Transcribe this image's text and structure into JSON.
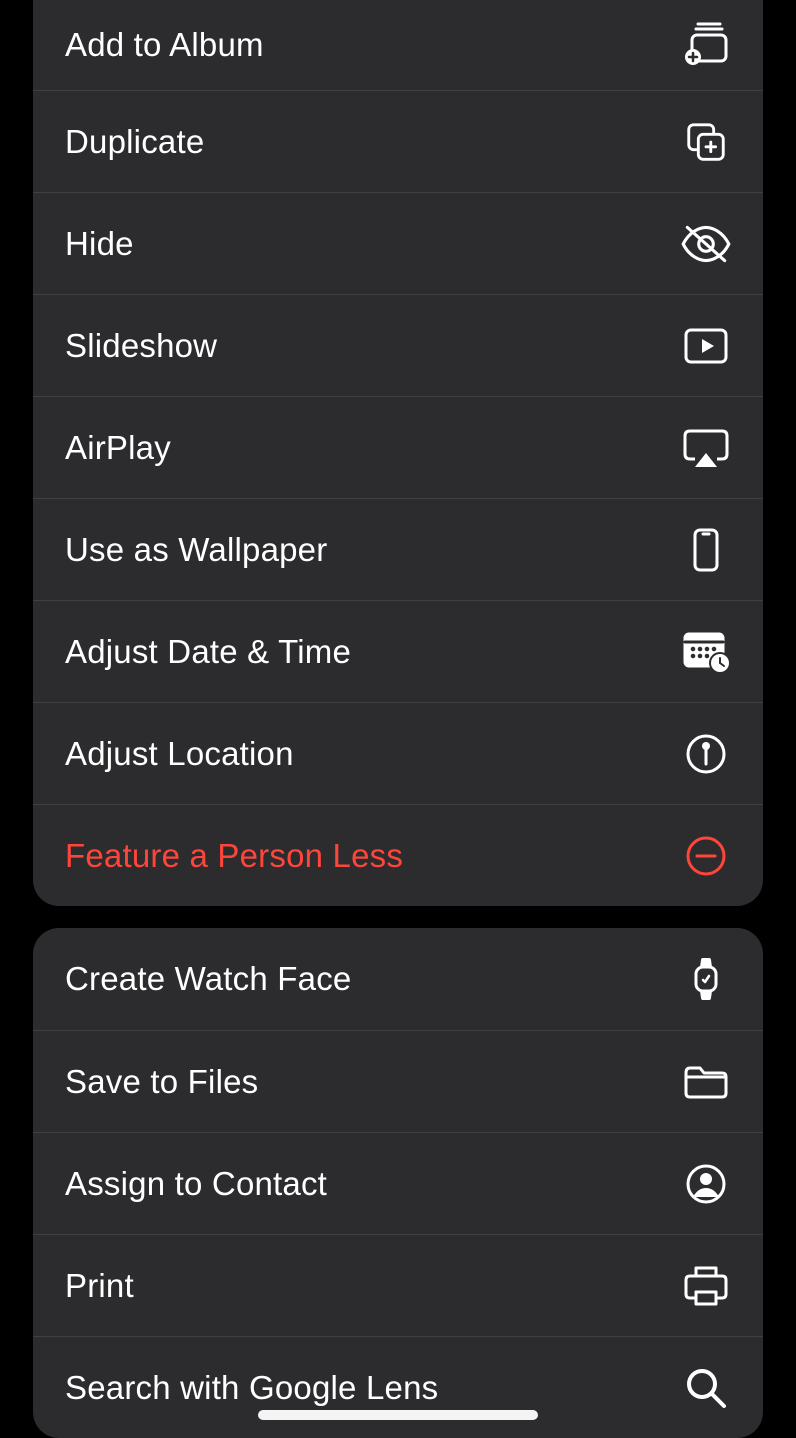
{
  "groups": [
    {
      "items": [
        {
          "id": "add-to-album",
          "label": "Add to Album",
          "icon": "album-add-icon"
        },
        {
          "id": "duplicate",
          "label": "Duplicate",
          "icon": "duplicate-icon"
        },
        {
          "id": "hide",
          "label": "Hide",
          "icon": "eye-slash-icon"
        },
        {
          "id": "slideshow",
          "label": "Slideshow",
          "icon": "play-rect-icon"
        },
        {
          "id": "airplay",
          "label": "AirPlay",
          "icon": "airplay-icon"
        },
        {
          "id": "use-as-wallpaper",
          "label": "Use as Wallpaper",
          "icon": "phone-icon"
        },
        {
          "id": "adjust-date-time",
          "label": "Adjust Date & Time",
          "icon": "calendar-clock-icon"
        },
        {
          "id": "adjust-location",
          "label": "Adjust Location",
          "icon": "pin-circle-icon"
        },
        {
          "id": "feature-less",
          "label": "Feature a Person Less",
          "icon": "minus-circle-icon",
          "destructive": true
        }
      ]
    },
    {
      "items": [
        {
          "id": "create-watch-face",
          "label": "Create Watch Face",
          "icon": "watch-icon"
        },
        {
          "id": "save-to-files",
          "label": "Save to Files",
          "icon": "folder-icon"
        },
        {
          "id": "assign-to-contact",
          "label": "Assign to Contact",
          "icon": "person-circle-icon"
        },
        {
          "id": "print",
          "label": "Print",
          "icon": "printer-icon"
        },
        {
          "id": "google-lens",
          "label": "Search with Google Lens",
          "icon": "search-icon"
        }
      ]
    }
  ]
}
